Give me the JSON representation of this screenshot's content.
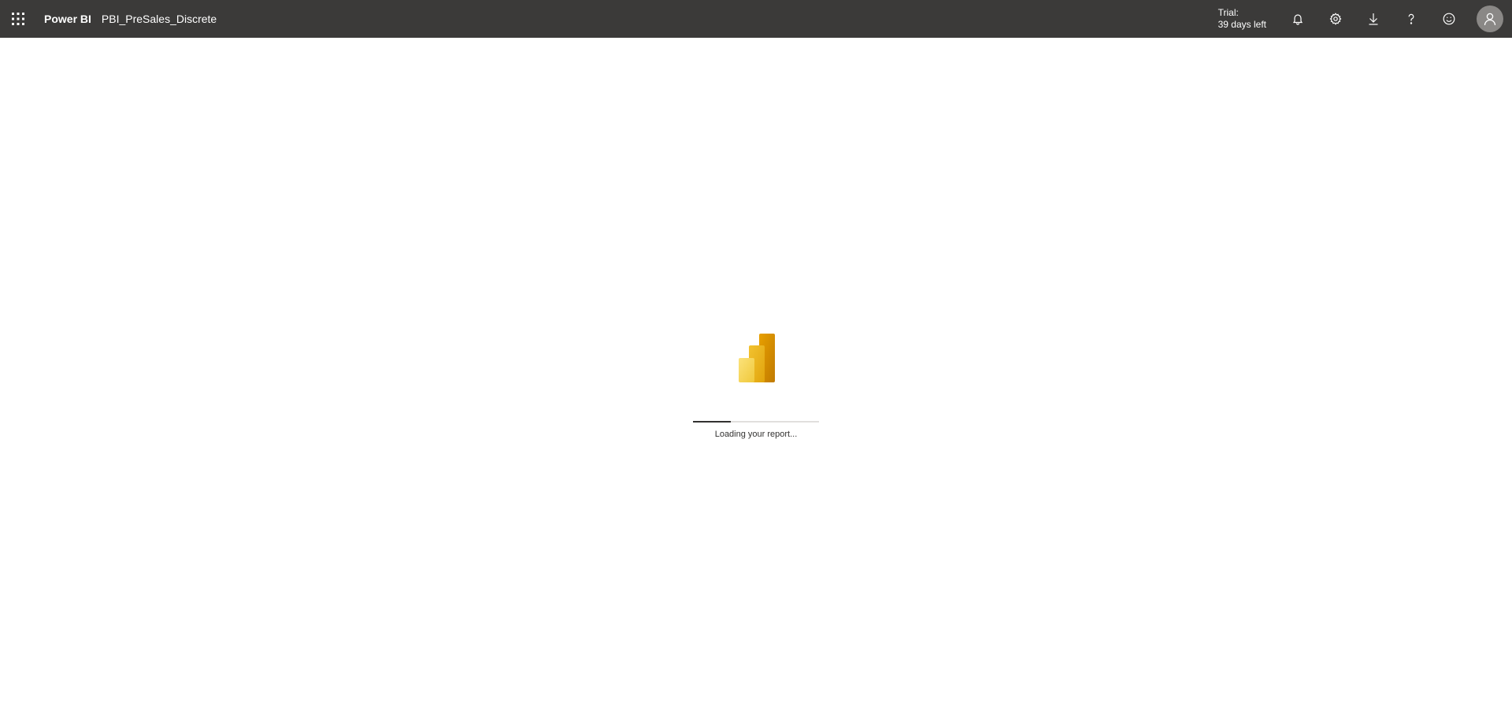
{
  "header": {
    "brand": "Power BI",
    "report_name": "PBI_PreSales_Discrete",
    "trial_line1": "Trial:",
    "trial_line2": "39 days left",
    "icons": [
      "app-launcher-icon",
      "bell-icon",
      "gear-icon",
      "download-icon",
      "help-icon",
      "smiley-icon",
      "user-icon"
    ],
    "background_color": "#3b3a39"
  },
  "loading": {
    "message": "Loading your report...",
    "progress": 0.3,
    "logo": "power-bi-logo"
  }
}
